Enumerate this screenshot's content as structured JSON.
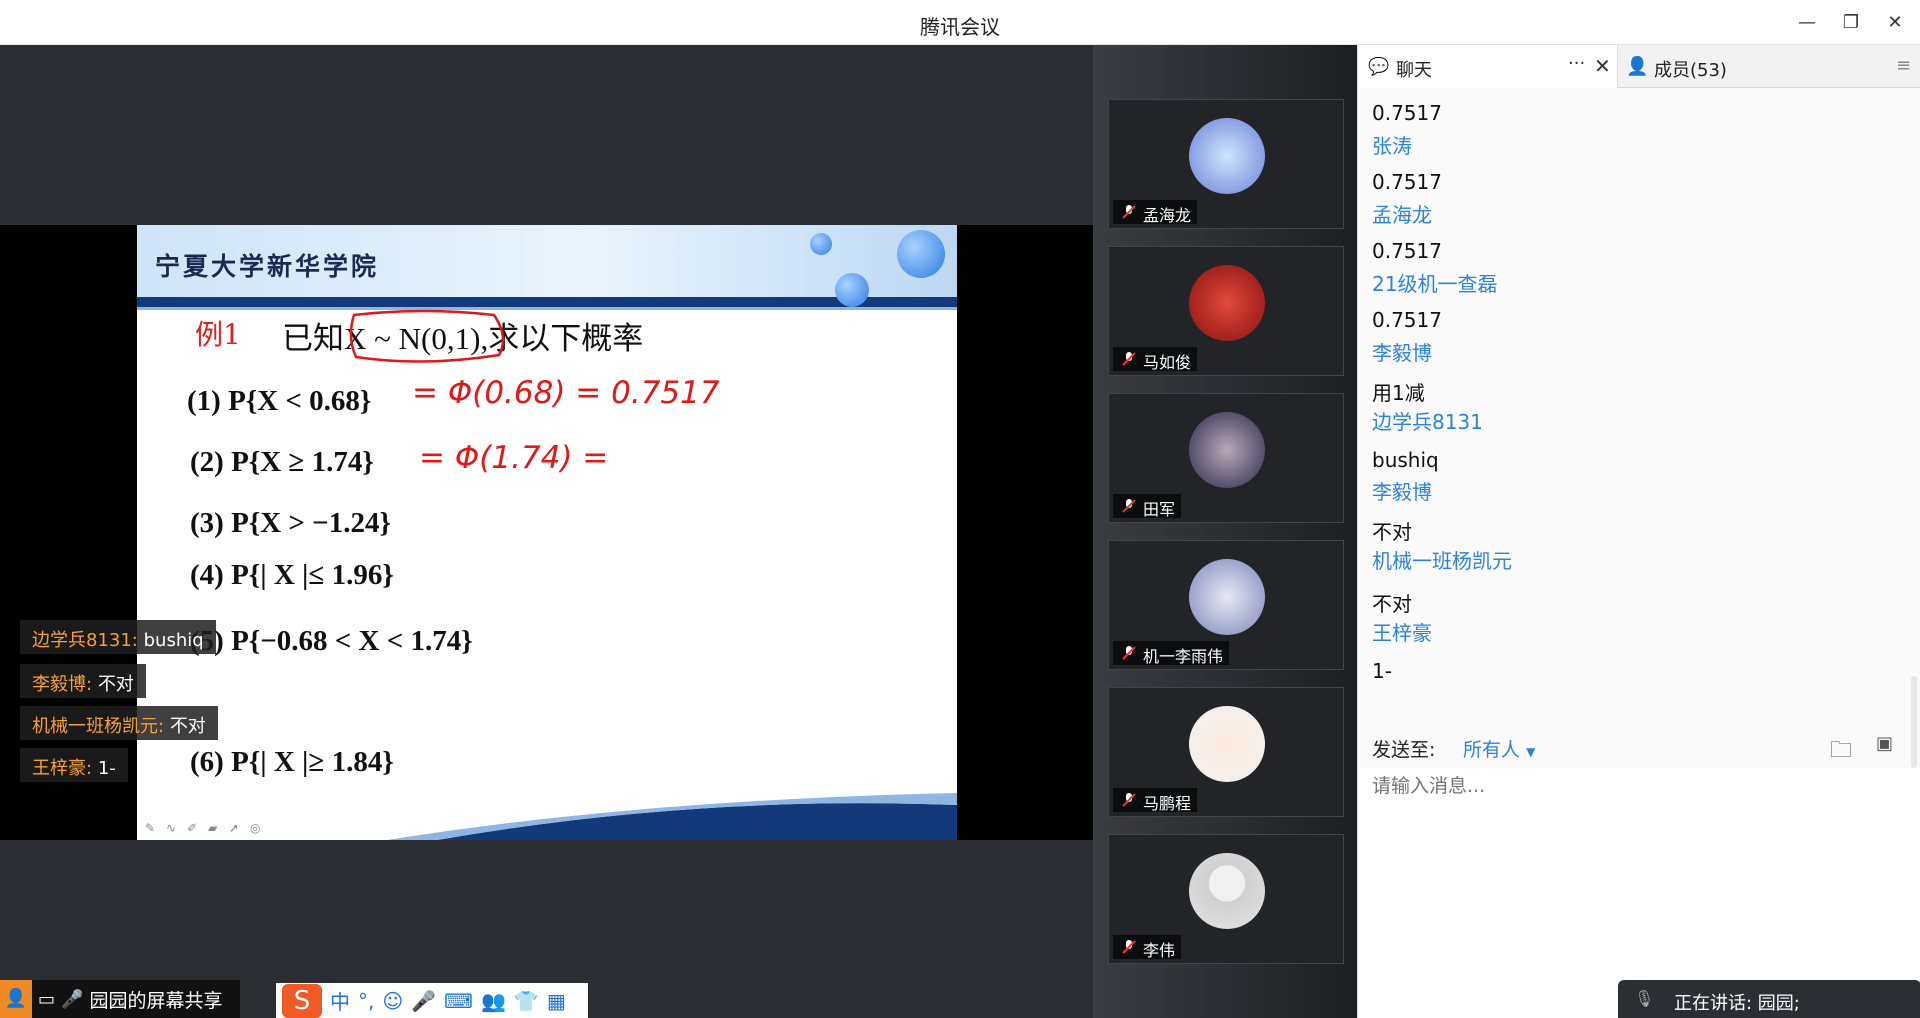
{
  "window": {
    "title": "腾讯会议"
  },
  "slide": {
    "school": "宁夏大学新华学院",
    "example_label": "例1",
    "example_text": "已知X ~ N(0,1),求以下概率",
    "problems": [
      "(1)  P{X < 0.68}",
      "(2)  P{X ≥ 1.74}",
      "(3)  P{X > −1.24}",
      "(4)  P{| X |≤ 1.96}",
      "(5)  P{−0.68 < X < 1.74}",
      "(6)  P{| X |≥ 1.84}"
    ],
    "annotations": [
      "= Φ(0.68) = 0.7517",
      "= Φ(1.74) ="
    ]
  },
  "danmu": [
    {
      "name": "边学兵8131:",
      "msg": "bushiq"
    },
    {
      "name": "李毅博:",
      "msg": "不对"
    },
    {
      "name": "机械一班杨凯元:",
      "msg": "不对"
    },
    {
      "name": "王梓豪:",
      "msg": "1-"
    }
  ],
  "participants": [
    "孟海龙",
    "马如俊",
    "田军",
    "机一李雨伟",
    "马鹏程",
    "李伟"
  ],
  "panel": {
    "tab_chat": "聊天",
    "tab_members": "成员(53)",
    "messages": [
      {
        "type": "text",
        "value": "0.7517"
      },
      {
        "type": "name",
        "value": "张涛"
      },
      {
        "type": "text",
        "value": "0.7517"
      },
      {
        "type": "name",
        "value": "孟海龙"
      },
      {
        "type": "text",
        "value": "0.7517"
      },
      {
        "type": "name",
        "value": "21级机一查磊"
      },
      {
        "type": "text",
        "value": "0.7517"
      },
      {
        "type": "name",
        "value": "李毅博"
      },
      {
        "type": "text",
        "value": "用1减"
      },
      {
        "type": "name",
        "value": "边学兵8131"
      },
      {
        "type": "text",
        "value": "bushiq"
      },
      {
        "type": "name",
        "value": "李毅博"
      },
      {
        "type": "text",
        "value": "不对"
      },
      {
        "type": "name",
        "value": "机械一班杨凯元"
      },
      {
        "type": "text",
        "value": "不对"
      },
      {
        "type": "name",
        "value": "王梓豪"
      },
      {
        "type": "text",
        "value": "1-"
      }
    ],
    "send_to_label": "发送至:",
    "send_to_target": "所有人",
    "input_placeholder": "请输入消息...",
    "speaking": "正在讲话: 园园;"
  },
  "bottom": {
    "share_label": "园园的屏幕共享"
  },
  "ime": {
    "items": [
      "中",
      "°,",
      "☺"
    ]
  }
}
